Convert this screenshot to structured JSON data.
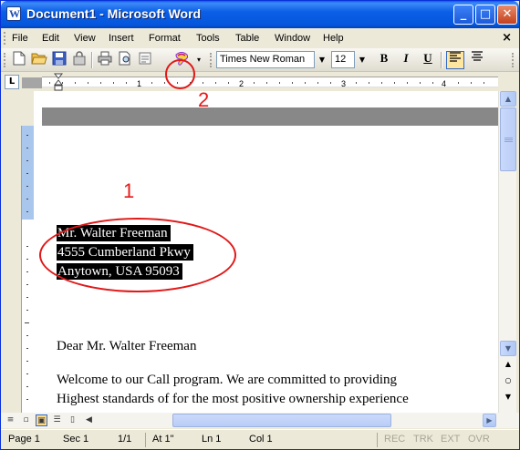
{
  "window": {
    "title": "Document1 - Microsoft Word",
    "minimize_glyph": "_",
    "maximize_glyph": "□",
    "close_glyph": "✕"
  },
  "menu": {
    "items": [
      "File",
      "Edit",
      "View",
      "Insert",
      "Format",
      "Tools",
      "Table",
      "Window",
      "Help"
    ],
    "close_glyph": "×"
  },
  "toolbar": {
    "font_name": "Times New Roman",
    "font_size": "12",
    "bold_label": "B",
    "italic_label": "I",
    "underline_label": "U",
    "icons": [
      "new-document-icon",
      "open-folder-icon",
      "save-icon",
      "permission-icon",
      "print-icon",
      "print-preview-icon",
      "format-painter-icon"
    ]
  },
  "ruler": {
    "tab_selector": "L",
    "numbers": [
      "1",
      "2",
      "3",
      "4"
    ]
  },
  "document": {
    "address_lines": [
      "Mr. Walter Freeman",
      "4555 Cumberland Pkwy",
      "Anytown, USA 95093"
    ],
    "salutation": "Dear Mr. Walter Freeman",
    "body_lines": [
      "Welcome to our Call program.  We are committed to providing",
      "Highest standards of for the most positive ownership experience"
    ]
  },
  "annotations": {
    "label_1": "1",
    "label_2": "2",
    "color": "#e8191a"
  },
  "statusbar": {
    "page": "Page 1",
    "section": "Sec 1",
    "page_of": "1/1",
    "at": "At 1\"",
    "line": "Ln 1",
    "col": "Col 1",
    "rec": "REC",
    "trk": "TRK",
    "ext": "EXT",
    "ovr": "OVR"
  },
  "colors": {
    "title_bar": "#0b5fe6",
    "selection": "#000000",
    "annotation": "#e8191a"
  }
}
